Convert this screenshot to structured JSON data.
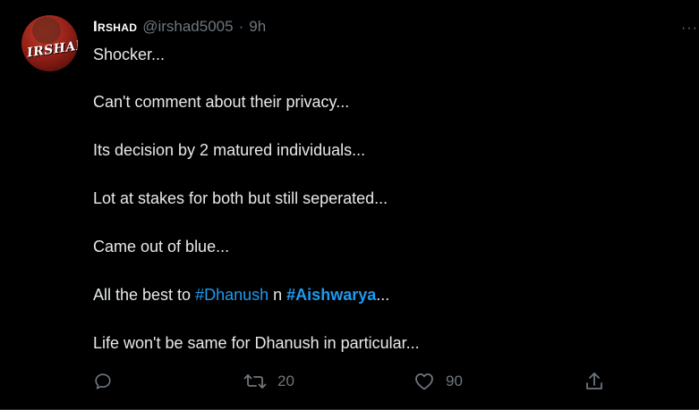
{
  "tweet": {
    "author_name": "Irshad",
    "author_handle": "@irshad5005",
    "separator": "·",
    "time_ago": "9h",
    "avatar_text": "IRSHAD",
    "more_label": "···",
    "lines": {
      "l1": "Shocker...",
      "l2": "Can't comment about their privacy...",
      "l3": "Its decision by 2 matured individuals...",
      "l4": "Lot at stakes for both but still seperated...",
      "l5": "Came out of blue...",
      "l6_prefix": "All the best to ",
      "l6_tag1": "#Dhanush",
      "l6_mid": " n ",
      "l6_tag2": "#Aishwarya",
      "l6_suffix": "...",
      "l7": "Life won't be same for Dhanush in particular..."
    },
    "actions": {
      "reply_icon": "reply-icon",
      "retweet_icon": "retweet-icon",
      "retweet_count": "20",
      "like_icon": "heart-icon",
      "like_count": "90",
      "share_icon": "share-icon"
    }
  },
  "colors": {
    "background": "#000000",
    "text": "#e7e9ea",
    "muted": "#6e767d",
    "hashtag": "#1d9bf0",
    "avatar_accent": "#c53a2a"
  }
}
